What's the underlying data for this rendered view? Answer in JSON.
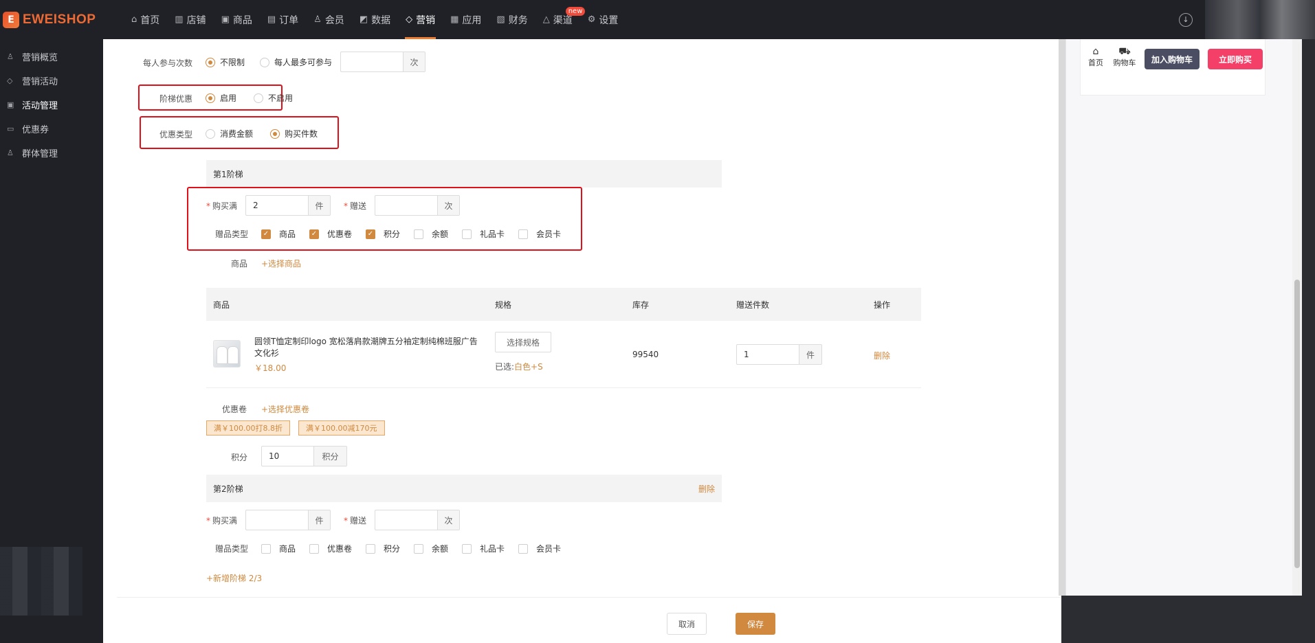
{
  "brand": {
    "logo_mark": "E",
    "name": "EWEISHOP"
  },
  "nav": [
    {
      "icon": "⌂",
      "label": "首页"
    },
    {
      "icon": "▥",
      "label": "店铺"
    },
    {
      "icon": "▣",
      "label": "商品"
    },
    {
      "icon": "▤",
      "label": "订单"
    },
    {
      "icon": "♙",
      "label": "会员"
    },
    {
      "icon": "◩",
      "label": "数据"
    },
    {
      "icon": "◇",
      "label": "营销"
    },
    {
      "icon": "▦",
      "label": "应用"
    },
    {
      "icon": "▧",
      "label": "财务"
    },
    {
      "icon": "△",
      "label": "渠道",
      "badge": "new"
    },
    {
      "icon": "⚙",
      "label": "设置"
    }
  ],
  "topright": {
    "download_icon": "↓"
  },
  "sidebar": [
    {
      "icon": "♙",
      "label": "营销概览"
    },
    {
      "icon": "◇",
      "label": "营销活动"
    },
    {
      "icon": "▣",
      "label": "活动管理"
    },
    {
      "icon": "▭",
      "label": "优惠券"
    },
    {
      "icon": "♙",
      "label": "群体管理"
    }
  ],
  "form": {
    "participation": {
      "label": "每人参与次数",
      "opt_unlimited": "不限制",
      "opt_max": "每人最多可参与",
      "value": "",
      "suffix": "次"
    },
    "tier_discount": {
      "label": "阶梯优惠",
      "opt_on": "启用",
      "opt_off": "不启用"
    },
    "discount_type": {
      "label": "优惠类型",
      "opt_amount": "消费金额",
      "opt_qty": "购买件数"
    },
    "tier1": {
      "title": "第1阶梯",
      "buy_label": "购买满",
      "buy_value": "2",
      "buy_suffix": "件",
      "gift_label": "赠送",
      "gift_value": "",
      "gift_suffix": "次",
      "gift_type_label": "赠品类型",
      "gift_types": [
        "商品",
        "优惠卷",
        "积分",
        "余额",
        "礼品卡",
        "会员卡"
      ],
      "product_label": "商品",
      "select_product": "+选择商品",
      "table": {
        "headers": [
          "商品",
          "规格",
          "库存",
          "赠送件数",
          "操作"
        ],
        "row": {
          "name": "圆领T恤定制印logo 宽松落肩款潮牌五分袖定制纯棉班服广告文化衫",
          "price": "￥18.00",
          "spec_btn": "选择规格",
          "selected_prefix": "已选:",
          "selected_value": "白色+S",
          "stock": "99540",
          "gift_qty": "1",
          "gift_qty_suffix": "件",
          "action": "删除"
        }
      },
      "coupon_label": "优惠卷",
      "select_coupon": "+选择优惠卷",
      "coupons": [
        "满￥100.00打8.8折",
        "满￥100.00减170元"
      ],
      "points_label": "积分",
      "points_value": "10",
      "points_suffix": "积分"
    },
    "tier2": {
      "title": "第2阶梯",
      "delete": "删除",
      "buy_label": "购买满",
      "buy_value": "",
      "buy_suffix": "件",
      "gift_label": "赠送",
      "gift_value": "",
      "gift_suffix": "次",
      "gift_type_label": "赠品类型",
      "gift_types": [
        "商品",
        "优惠卷",
        "积分",
        "余额",
        "礼品卡",
        "会员卡"
      ]
    },
    "add_tier": "+新增阶梯 2/3"
  },
  "preview": {
    "home": "首页",
    "cart": "购物车",
    "add_cart": "加入购物车",
    "buy_now": "立即购买"
  },
  "footer": {
    "cancel": "取消",
    "save": "保存"
  },
  "colors": {
    "accent": "#d0893e",
    "highlight_box": "#e0101a",
    "buy_now": "#f43f68",
    "add_cart": "#4b4e63"
  }
}
